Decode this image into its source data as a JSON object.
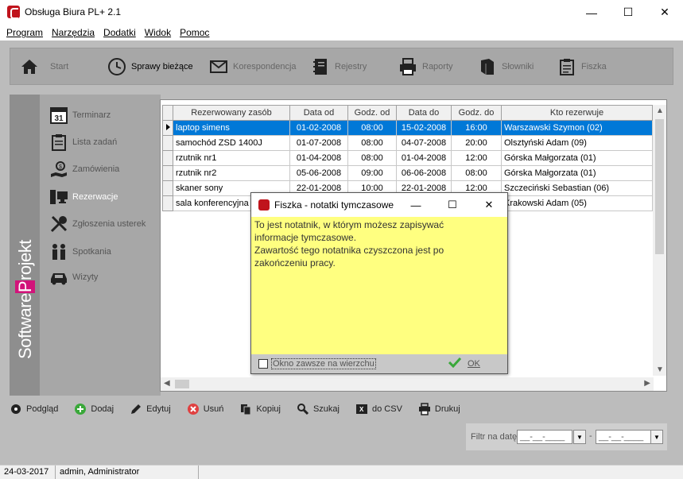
{
  "window": {
    "title": "Obsługa Biura PL+ 2.1",
    "minimize": "—",
    "maximize": "☐",
    "close": "✕"
  },
  "menu": [
    "Program",
    "Narzędzia",
    "Dodatki",
    "Widok",
    "Pomoc"
  ],
  "toolbar": {
    "items": [
      {
        "label": "Start",
        "icon": "home-icon"
      },
      {
        "label": "Sprawy bieżące",
        "icon": "clock-icon"
      },
      {
        "label": "Korespondencja",
        "icon": "envelope-icon"
      },
      {
        "label": "Rejestry",
        "icon": "binder-icon"
      },
      {
        "label": "Raporty",
        "icon": "printer-icon"
      },
      {
        "label": "Słowniki",
        "icon": "book-icon"
      },
      {
        "label": "Fiszka",
        "icon": "clipboard-icon"
      }
    ],
    "active": "Sprawy bieżące"
  },
  "sidebar": {
    "brand": "SoftwareProjekt",
    "items": [
      {
        "label": "Terminarz",
        "icon": "calendar-icon"
      },
      {
        "label": "Lista zadań",
        "icon": "checklist-icon"
      },
      {
        "label": "Zamówienia",
        "icon": "order-icon"
      },
      {
        "label": "Rezerwacje",
        "icon": "computer-icon"
      },
      {
        "label": "Zgłoszenia usterek",
        "icon": "tools-icon"
      },
      {
        "label": "Spotkania",
        "icon": "people-icon"
      },
      {
        "label": "Wizyty",
        "icon": "car-icon"
      }
    ],
    "active": "Rezerwacje"
  },
  "grid": {
    "columns": [
      "Rezerwowany zasób",
      "Data od",
      "Godz. od",
      "Data do",
      "Godz. do",
      "Kto rezerwuje"
    ],
    "rows": [
      [
        "laptop simens",
        "01-02-2008",
        "08:00",
        "15-02-2008",
        "16:00",
        "Warszawski Szymon (02)"
      ],
      [
        "samochód ZSD 1400J",
        "01-07-2008",
        "08:00",
        "04-07-2008",
        "20:00",
        "Olsztyński Adam (09)"
      ],
      [
        "rzutnik nr1",
        "01-04-2008",
        "08:00",
        "01-04-2008",
        "12:00",
        "Górska Małgorzata (01)"
      ],
      [
        "rzutnik nr2",
        "05-06-2008",
        "09:00",
        "06-06-2008",
        "08:00",
        "Górska Małgorzata (01)"
      ],
      [
        "skaner sony",
        "22-01-2008",
        "10:00",
        "22-01-2008",
        "12:00",
        "Szczeciński Sebastian (06)"
      ],
      [
        "sala konferencyjna",
        "",
        "",
        "",
        "",
        "Krakowski Adam (05)"
      ]
    ],
    "selected_row": 0
  },
  "bottom_toolbar": [
    {
      "label": "Podgląd",
      "icon": "eye-icon"
    },
    {
      "label": "Dodaj",
      "icon": "add-icon"
    },
    {
      "label": "Edytuj",
      "icon": "pencil-icon"
    },
    {
      "label": "Usuń",
      "icon": "delete-icon"
    },
    {
      "label": "Kopiuj",
      "icon": "copy-icon"
    },
    {
      "label": "Szukaj",
      "icon": "search-icon"
    },
    {
      "label": "do CSV",
      "icon": "excel-icon"
    },
    {
      "label": "Drukuj",
      "icon": "print-icon"
    }
  ],
  "filter": {
    "label": "Filtr na datę",
    "from": "__-__-____",
    "dash": "-",
    "to": "__-__-____"
  },
  "status": {
    "date": "24-03-2017",
    "user": "admin, Administrator"
  },
  "dialog": {
    "title": "Fiszka - notatki tymczasowe",
    "body": "To jest notatnik, w którym możesz zapisywać\ninformacje tymczasowe.\nZawartość tego notatnika czyszczona jest po\nzakończeniu pracy.",
    "checkbox_label": "Okno zawsze na wierzchu",
    "ok_label": "OK"
  },
  "colors": {
    "selection": "#0078d7",
    "note_bg": "#ffff80",
    "brand_accent": "#d2137a"
  }
}
